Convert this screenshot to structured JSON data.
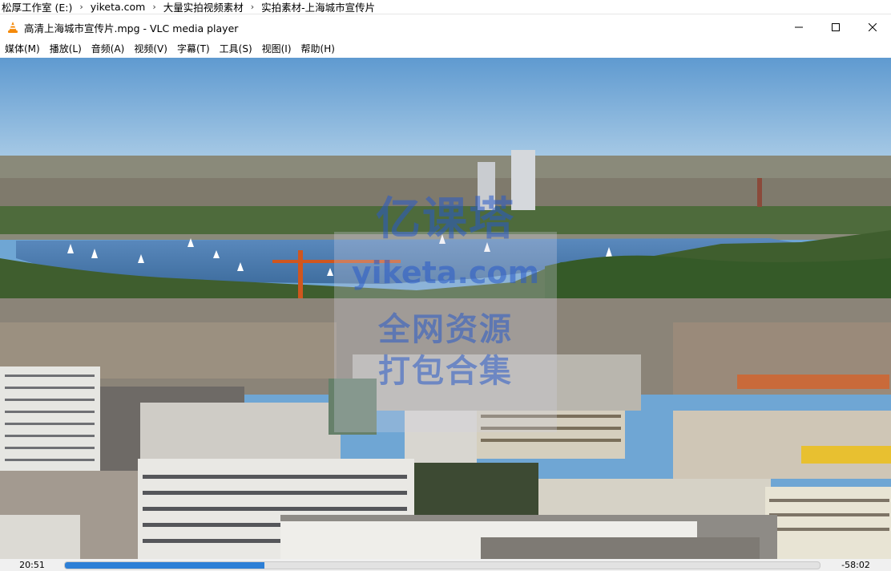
{
  "breadcrumb": {
    "items": [
      "松厚工作室 (E:)",
      "yiketa.com",
      "大量实拍视频素材",
      "实拍素材-上海城市宣传片"
    ],
    "separator": "›"
  },
  "window": {
    "title": "高清上海城市宣传片.mpg - VLC media player",
    "app_icon": "vlc-cone-icon",
    "controls": [
      "minimize-icon",
      "maximize-icon",
      "close-icon"
    ]
  },
  "menu": {
    "items": [
      "媒体(M)",
      "播放(L)",
      "音频(A)",
      "视频(V)",
      "字幕(T)",
      "工具(S)",
      "视图(I)",
      "帮助(H)"
    ]
  },
  "watermark": {
    "line1": "亿课塔",
    "line2": "yiketa.com",
    "line3": "全网资源",
    "line4": "打包合集"
  },
  "playback": {
    "elapsed": "20:51",
    "remaining": "-58:02",
    "progress_fraction": 0.264
  },
  "colors": {
    "accent": "#2d7fd6",
    "vlc_orange": "#f58a0a"
  }
}
